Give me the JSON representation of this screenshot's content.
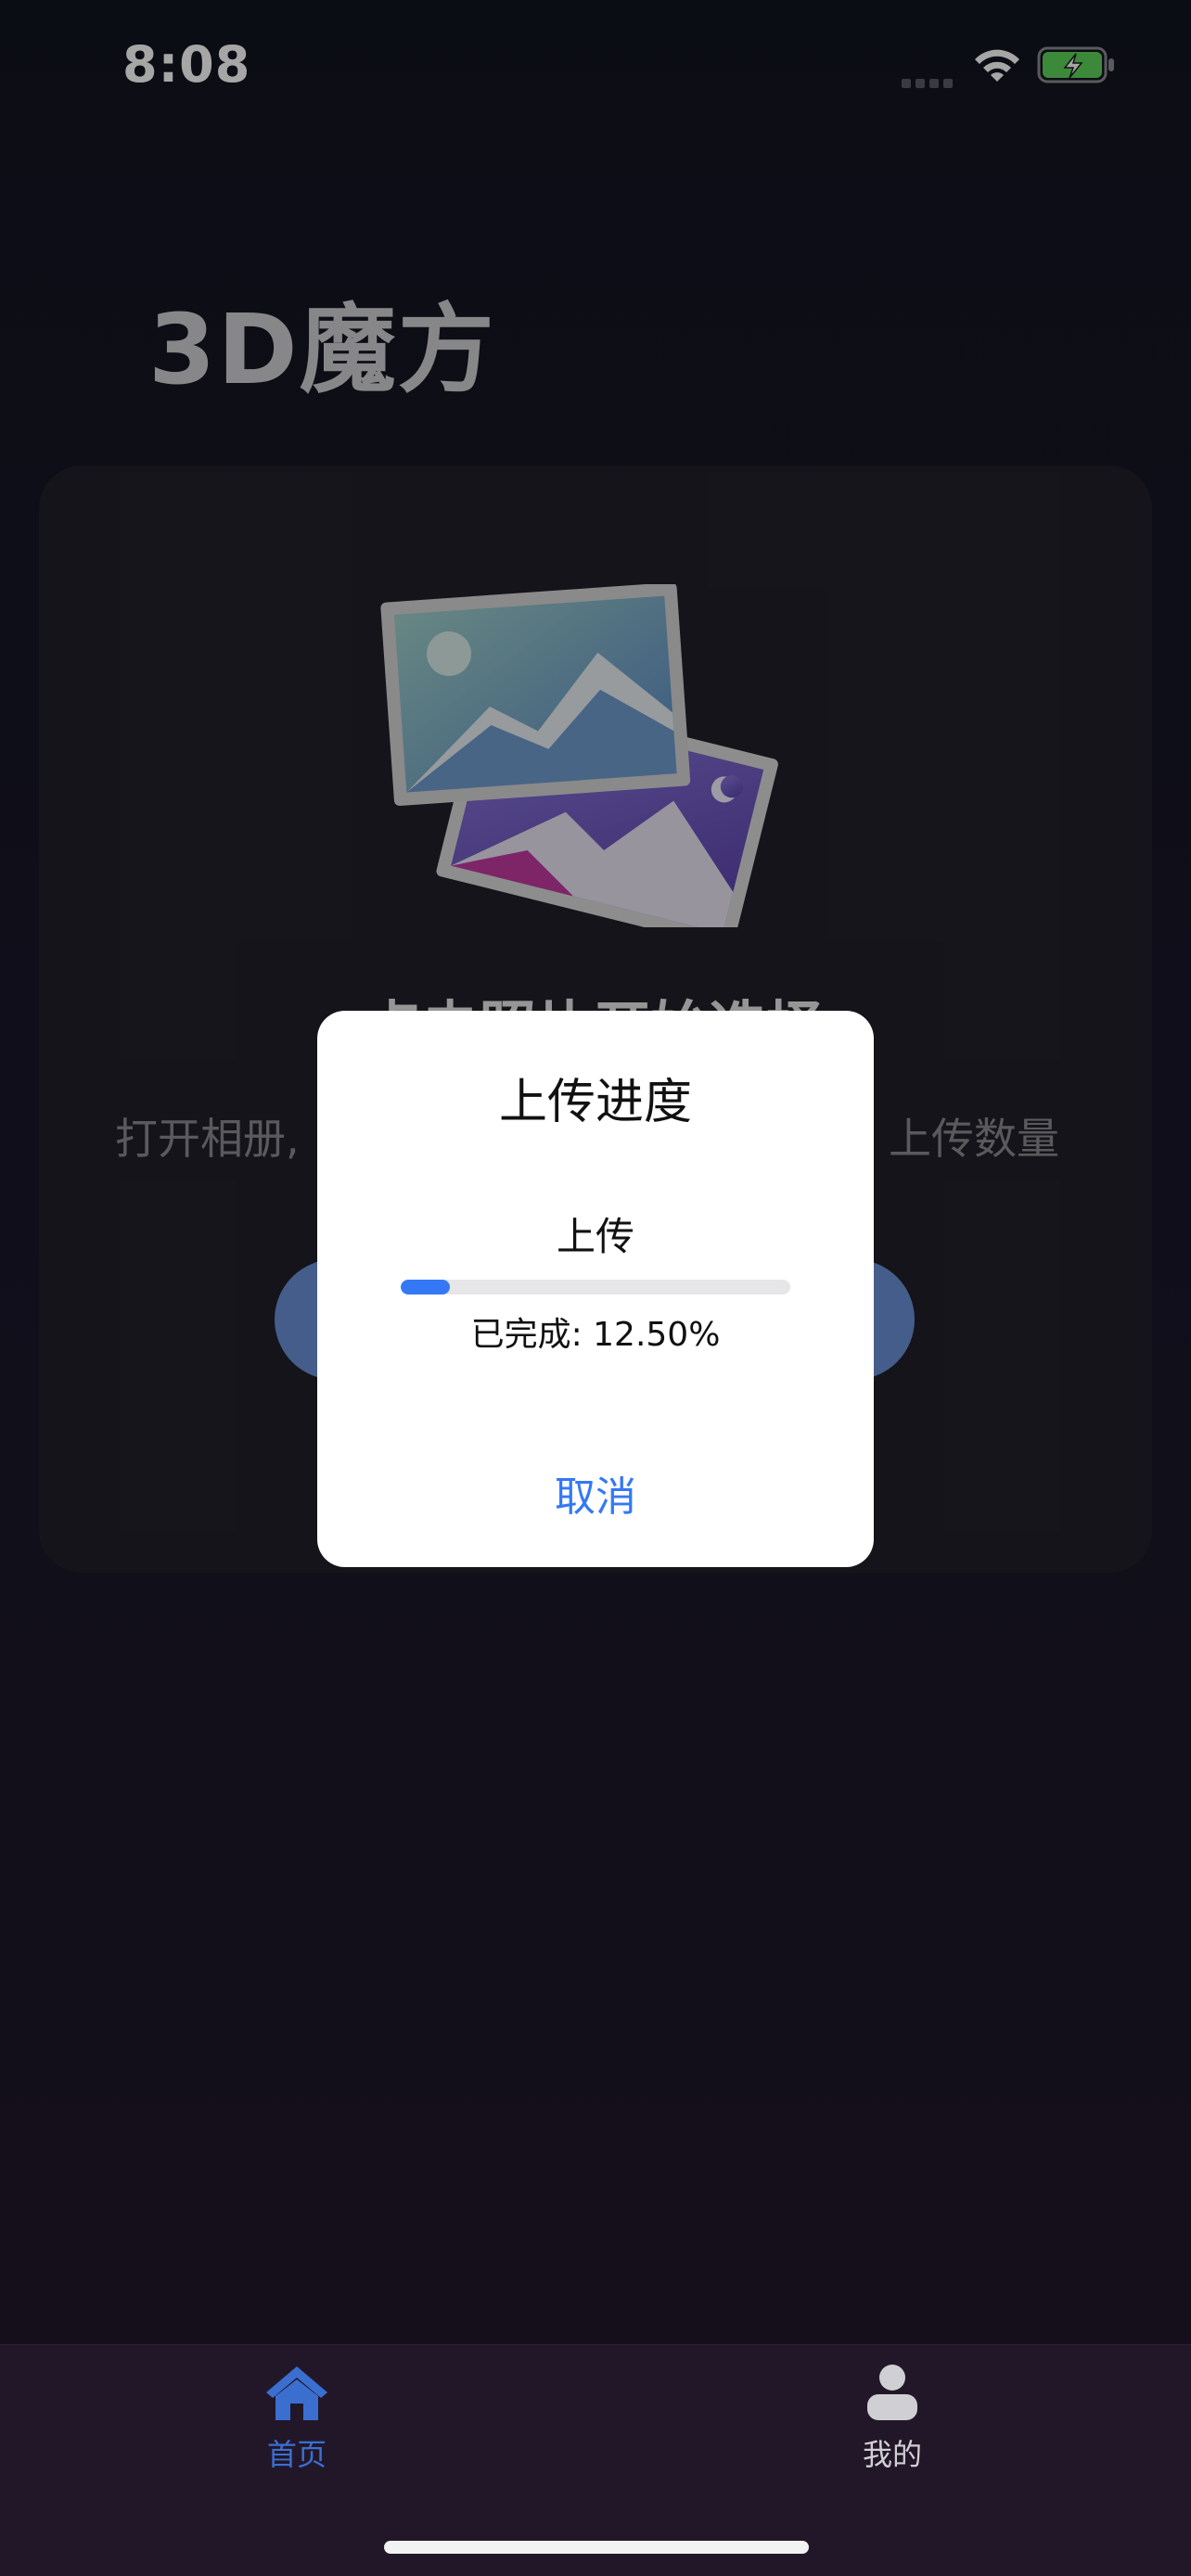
{
  "status_bar": {
    "time": "8:08",
    "signal_icon": "cellular-signal-icon",
    "wifi_icon": "wifi-icon",
    "battery_icon": "battery-charging-icon"
  },
  "app_title": "3D魔方",
  "card": {
    "image_icon": "photo-album-icon",
    "heading": "点击照片开始选择",
    "description_left": "打开相册,",
    "description_right": "上传数量"
  },
  "dialog": {
    "title": "上传进度",
    "upload_label": "上传",
    "progress_percent": 12.5,
    "progress_text": "已完成: 12.50%",
    "cancel_label": "取消"
  },
  "tab_bar": {
    "tabs": [
      {
        "label": "首页",
        "icon": "home-icon",
        "active": true
      },
      {
        "label": "我的",
        "icon": "person-icon",
        "active": false
      }
    ]
  },
  "colors": {
    "accent": "#3478f6",
    "active_tab": "#3a6fd0",
    "card_button": "#6a8fd4",
    "battery_green": "#5dd35a"
  }
}
